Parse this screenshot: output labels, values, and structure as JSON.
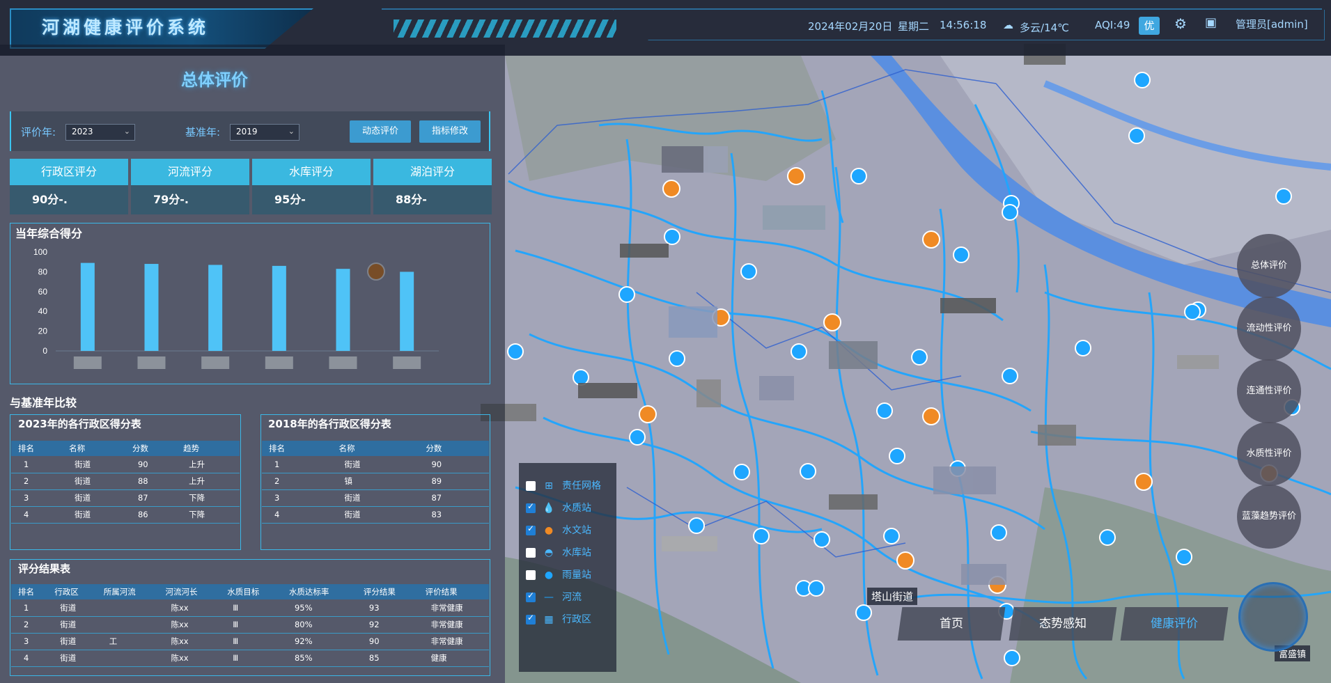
{
  "header": {
    "title": "河湖健康评价系统",
    "date": "2024年02月20日",
    "weekday": "星期二",
    "time": "14:56:18",
    "weather": "多云/14℃",
    "aqi": "AQI:49",
    "aqi_badge": "优",
    "user": "管理员[admin]"
  },
  "panel": {
    "title": "总体评价",
    "eval_year_label": "评价年:",
    "eval_year_value": "2023",
    "base_year_label": "基准年:",
    "base_year_value": "2019",
    "btn_dynamic": "动态评价",
    "btn_modify": "指标修改",
    "scores": [
      {
        "label": "行政区评分",
        "value": "90分-."
      },
      {
        "label": "河流评分",
        "value": "79分-."
      },
      {
        "label": "水库评分",
        "value": "95分-"
      },
      {
        "label": "湖泊评分",
        "value": "88分-"
      }
    ],
    "annual_title": "当年综合得分",
    "compare_title": "与基准年比较",
    "table_a_title": "2023年的各行政区得分表",
    "table_b_title": "2018年的各行政区得分表",
    "result_title": "评分结果表"
  },
  "chart_data": {
    "type": "bar",
    "categories": [
      "",
      "",
      "",
      "",
      "",
      ""
    ],
    "values": [
      89,
      88,
      87,
      86,
      83,
      80
    ],
    "ylim": [
      0,
      100
    ],
    "yticks": [
      "100",
      "80",
      "60",
      "40",
      "20",
      "0"
    ],
    "color": "#4fc3f7"
  },
  "table_a": {
    "headers": [
      "排名",
      "名称",
      "分数",
      "趋势"
    ],
    "rows": [
      [
        "1",
        "街道",
        "90",
        "上升"
      ],
      [
        "2",
        "街道",
        "88",
        "上升"
      ],
      [
        "3",
        "街道",
        "87",
        "下降"
      ],
      [
        "4",
        "街道",
        "86",
        "下降"
      ]
    ]
  },
  "table_b": {
    "headers": [
      "排名",
      "名称",
      "分数"
    ],
    "rows": [
      [
        "1",
        "街道",
        "90"
      ],
      [
        "2",
        "镇",
        "89"
      ],
      [
        "3",
        "街道",
        "87"
      ],
      [
        "4",
        "街道",
        "83"
      ]
    ]
  },
  "result_table": {
    "headers": [
      "排名",
      "行政区",
      "所属河流",
      "河流河长",
      "水质目标",
      "水质达标率",
      "评分结果",
      "评价结果"
    ],
    "rows": [
      [
        "1",
        "街道",
        "",
        "陈xx",
        "Ⅲ",
        "95%",
        "93",
        "非常健康"
      ],
      [
        "2",
        "街道",
        "",
        "陈xx",
        "Ⅲ",
        "80%",
        "92",
        "非常健康"
      ],
      [
        "3",
        "街道",
        "工",
        "陈xx",
        "Ⅲ",
        "92%",
        "90",
        "非常健康"
      ],
      [
        "4",
        "街道",
        "",
        "陈xx",
        "Ⅲ",
        "85%",
        "85",
        "健康"
      ]
    ]
  },
  "legend": [
    {
      "label": "责任网格",
      "checked": false,
      "icon": "grid-icon"
    },
    {
      "label": "水质站",
      "checked": true,
      "icon": "water-drop-icon"
    },
    {
      "label": "水文站",
      "checked": true,
      "icon": "hydrology-pin-icon"
    },
    {
      "label": "水库站",
      "checked": false,
      "icon": "reservoir-icon"
    },
    {
      "label": "雨量站",
      "checked": false,
      "icon": "rain-dot-icon"
    },
    {
      "label": "河流",
      "checked": true,
      "icon": "river-line-icon"
    },
    {
      "label": "行政区",
      "checked": true,
      "icon": "district-icon"
    }
  ],
  "right_menu": [
    "总体评价",
    "流动性评价",
    "连通性评价",
    "水质性评价",
    "蓝藻趋势评价"
  ],
  "bottom_nav": [
    "首页",
    "态势感知",
    "健康评价"
  ],
  "map_labels": [
    "塔山街道",
    "富盛镇"
  ]
}
